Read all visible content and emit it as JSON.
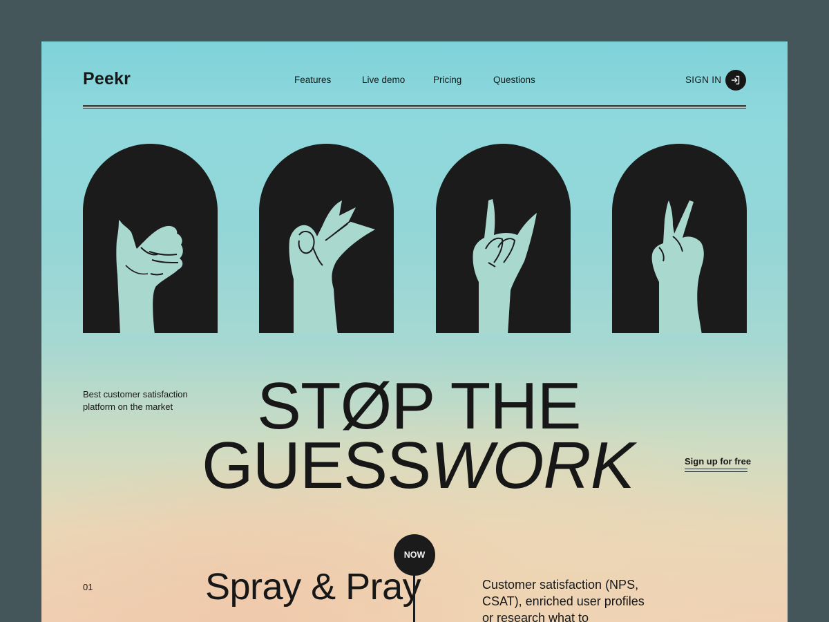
{
  "brand": {
    "name": "Peekr"
  },
  "nav": {
    "items": [
      {
        "label": "Features"
      },
      {
        "label": "Live demo"
      },
      {
        "label": "Pricing"
      },
      {
        "label": "Questions"
      }
    ],
    "sign_in": "SIGN IN",
    "sign_in_icon": "sign-in-arrow-icon"
  },
  "hero": {
    "arches": [
      {
        "icon": "thumbs-up-hand-icon"
      },
      {
        "icon": "ok-sign-hand-icon"
      },
      {
        "icon": "rock-on-hand-icon"
      },
      {
        "icon": "peace-sign-hand-icon"
      }
    ],
    "tagline": "Best customer satisfaction platform on the market",
    "headline_line1": "STØP THE",
    "headline_line2_regular": "GUESS",
    "headline_line2_italic": "WORK",
    "cta": "Sign up for free"
  },
  "section": {
    "number": "01",
    "title": "Spray & Pray",
    "badge": "NOW",
    "description": "Customer satisfaction (NPS, CSAT), enriched user profiles or research what to"
  },
  "colors": {
    "frame": "#44565a",
    "dark": "#1b1b1b",
    "hand": "#a9d8cf",
    "gradient_top": "#7fd2d9",
    "gradient_bottom": "#f0d0b4"
  }
}
